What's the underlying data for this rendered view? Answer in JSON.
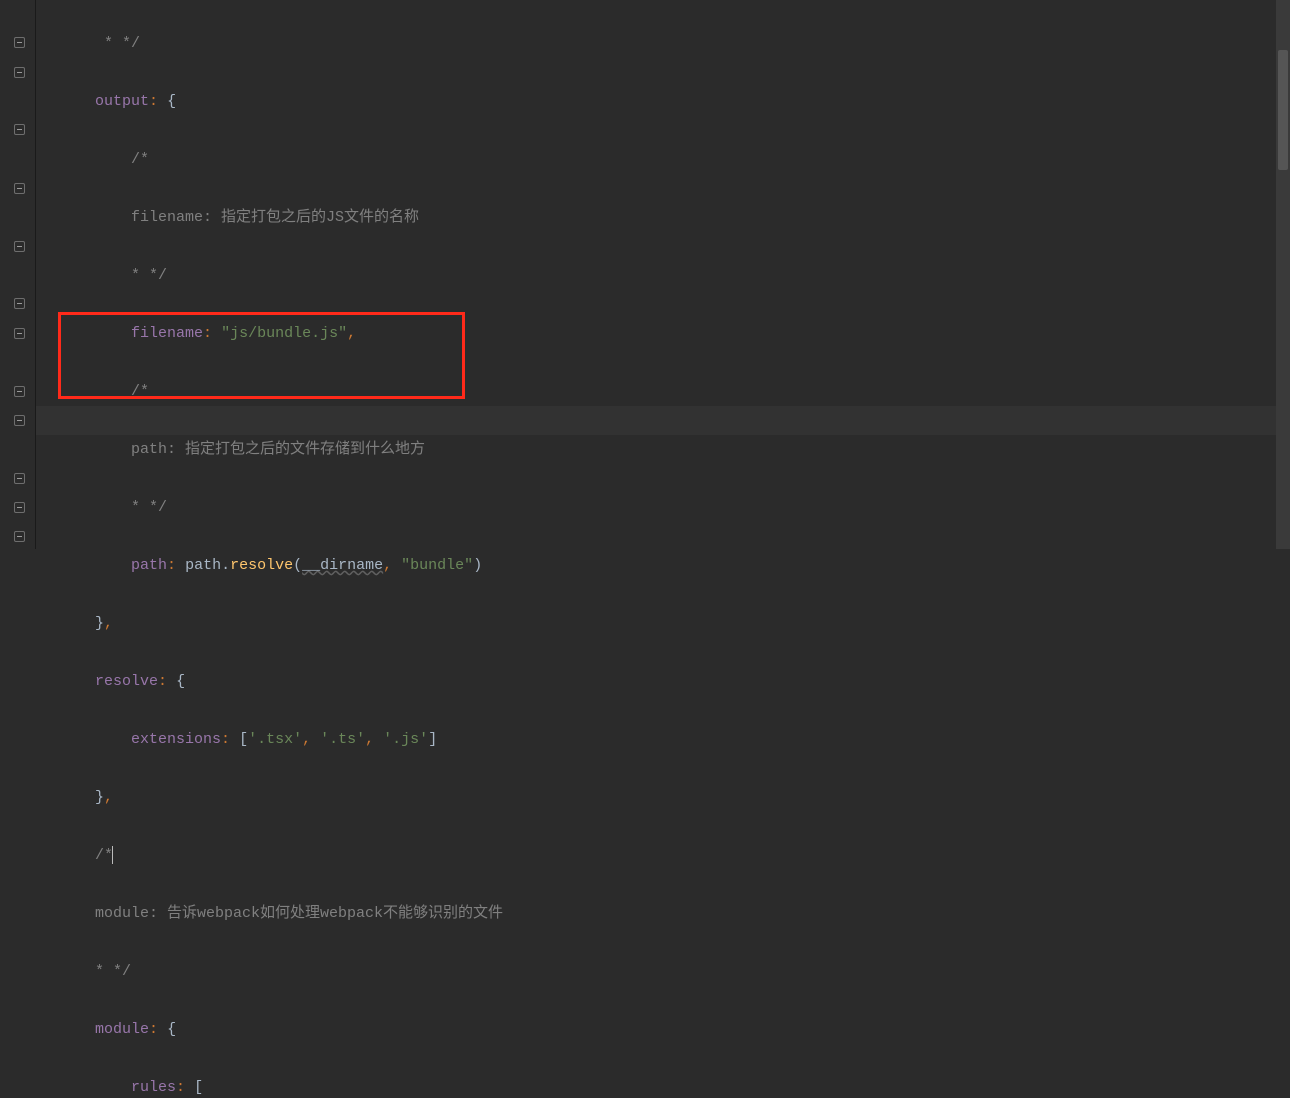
{
  "lines": {
    "l1": "* */",
    "output_key": "output",
    "brace_open": "{",
    "brace_close": "}",
    "comment_open": "/*",
    "filename_comment": "filename: 指定打包之后的JS文件的名称",
    "star_close": "* */",
    "filename_key": "filename",
    "filename_val": "\"js/bundle.js\"",
    "path_comment": "path: 指定打包之后的文件存储到什么地方",
    "path_key": "path",
    "path_ident": "path",
    "resolve_call": "resolve",
    "dirname": "__dirname",
    "bundle_str": "\"bundle\"",
    "resolve_key": "resolve",
    "extensions_key": "extensions",
    "ext_tsx": "'.tsx'",
    "ext_ts": "'.ts'",
    "ext_js": "'.js'",
    "module_comment": "module: 告诉webpack如何处理webpack不能够识别的文件",
    "module_key": "module",
    "rules_key": "rules",
    "colon": ":",
    "comma": ",",
    "lparen": "(",
    "rparen": ")",
    "lbracket": "[",
    "rbracket": "]",
    "dot": "."
  }
}
